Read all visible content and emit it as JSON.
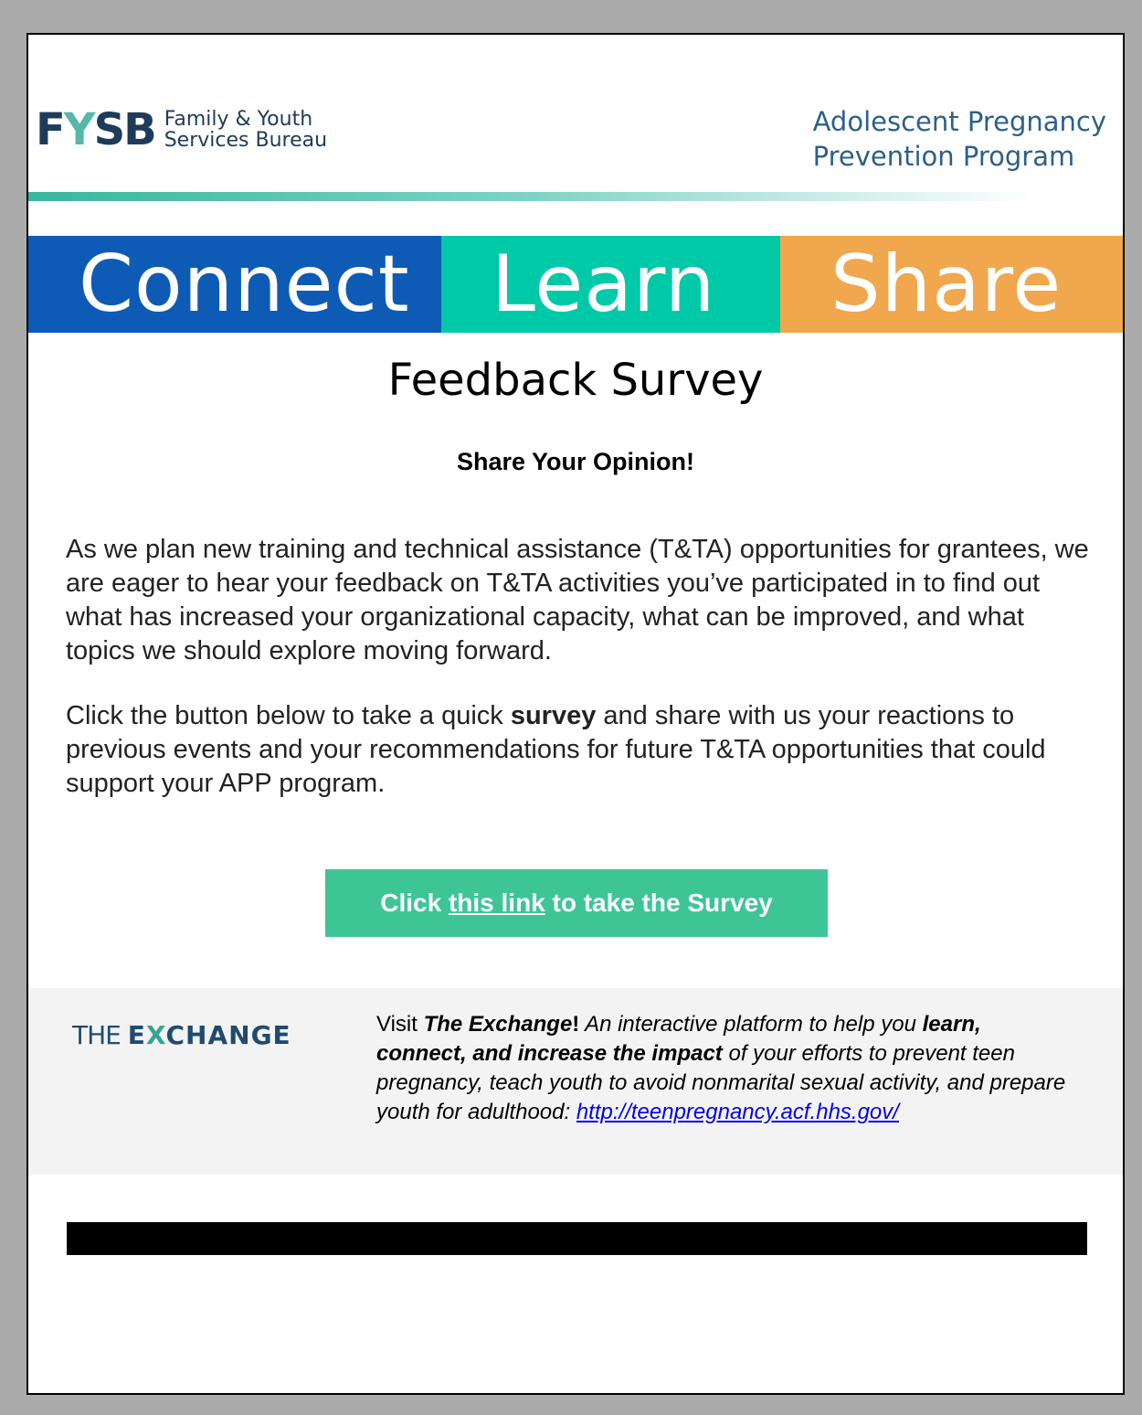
{
  "header": {
    "fysb_mark_f": "F",
    "fysb_mark_y": "Y",
    "fysb_mark_sb": "SB",
    "fysb_line1": "Family & Youth",
    "fysb_line2": "Services Bureau",
    "program_line1": "Adolescent Pregnancy",
    "program_line2": "Prevention Program"
  },
  "banner": {
    "connect": "Connect",
    "learn": "Learn",
    "share": "Share",
    "colors": {
      "connect": "#0e5bb5",
      "learn": "#00c9a7",
      "share": "#f0a74e"
    }
  },
  "main": {
    "title": "Feedback Survey",
    "subtitle": "Share Your Opinion!",
    "para1": "As we plan new training and technical assistance (T&TA) opportunities for grantees, we are eager to hear your feedback on T&TA activities you’ve participated in to find out what has increased your organizational capacity, what can be improved, and what topics we should explore moving forward.",
    "para2_before": "Click the button below to take a quick ",
    "para2_bold": "survey",
    "para2_after": " and share with us your reactions to previous events and your recommendations for future T&TA opportunities that could support your APP program."
  },
  "cta": {
    "prefix": "Click ",
    "link": "this link",
    "suffix": " to take the Survey",
    "color": "#3ec596"
  },
  "exchange": {
    "logo_the": "THE ",
    "logo_e": "E",
    "logo_x": "X",
    "logo_rest": "CHANGE",
    "visit": "Visit ",
    "name": "The Exchange",
    "bang": "!",
    "desc1": " An interactive platform to help you ",
    "desc_bold": "learn, connect, and increase the impact",
    "desc2": " of your efforts to prevent teen pregnancy, teach youth to avoid nonmarital sexual activity, and prepare youth for adulthood: ",
    "url": "http://teenpregnancy.acf.hhs.gov/"
  }
}
